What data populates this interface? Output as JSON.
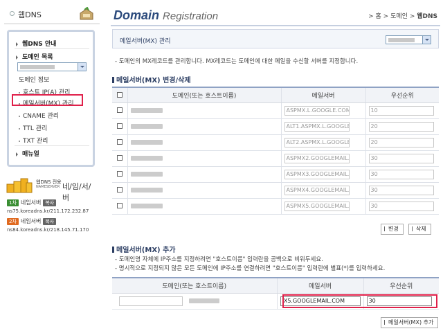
{
  "sidebar": {
    "title": "웹DNS",
    "menu": {
      "guide": "웹DNS 안내",
      "domain_list": "도메인 목록",
      "items": [
        "도메인 정보",
        "호스트 IP(A) 관리",
        "메일서버(MX) 관리",
        "CNAME 관리",
        "TTL 관리",
        "TXT 관리"
      ],
      "manual": "매뉴얼"
    },
    "nameserver": {
      "brand_small": "웹DNS 전용",
      "brand_sub": "NAMESERVER",
      "brand_big": "네/임/서/버",
      "primary": {
        "badge": "1차",
        "label": "네임서버",
        "copy": "복사",
        "address": "ns75.koreadns.kr/211.172.232.87"
      },
      "secondary": {
        "badge": "2차",
        "label": "네임서버",
        "copy": "복사",
        "address": "ns84.koreadns.kr/218.145.71.170"
      }
    }
  },
  "header": {
    "logo_main": "Domain",
    "logo_sub": "Registration",
    "breadcrumb": {
      "home": "홈",
      "sep": ">",
      "middle": "도메인",
      "current": "웹DNS"
    }
  },
  "panel": {
    "title": "메일서버(MX) 관리",
    "description": "- 도메인의 MX레코드를 관리합니다. MX레코드는 도메인에 대한 메일을 수신할 서버를 지정합니다."
  },
  "edit_section": {
    "title": "메일서버(MX) 변경/삭제",
    "columns": [
      "도메인(또는 호스트이름)",
      "메일서버",
      "우선순위"
    ],
    "rows": [
      {
        "mail": "ASPMX.L.GOOGLE.COM",
        "priority": "10"
      },
      {
        "mail": "ALT1.ASPMX.L.GOOGLE",
        "priority": "20"
      },
      {
        "mail": "ALT2.ASPMX.L.GOOGLE",
        "priority": "20"
      },
      {
        "mail": "ASPMX2.GOOGLEMAIL.",
        "priority": "30"
      },
      {
        "mail": "ASPMX3.GOOGLEMAIL.",
        "priority": "30"
      },
      {
        "mail": "ASPMX4.GOOGLEMAIL.",
        "priority": "30"
      },
      {
        "mail": "ASPMX5.GOOGLEMAIL.",
        "priority": "30"
      }
    ],
    "change_label": "변경",
    "delete_label": "삭제"
  },
  "add_section": {
    "title": "메일서버(MX) 추가",
    "notes": [
      "- 도메인명 자체에 IP주소를 지정하려면 \"호스트이름\" 입력란을 공백으로 비워두세요.",
      "- 명시적으로 지정되지 않은 모든 도메인에 IP주소를 연결하려면 \"호스트이름\" 입력란에 별표(*)를 입력하세요."
    ],
    "columns": [
      "도메인(또는 호스트이름)",
      "메일서버",
      "우선순위"
    ],
    "mail_value": "IX5.GOOGLEMAIL.COM",
    "priority_value": "30",
    "add_label": "메일서버(MX) 추가"
  },
  "colors": {
    "accent": "#2c3e63",
    "highlight": "#e0204a",
    "badge_green": "#3a8e33",
    "badge_orange": "#e06a20"
  }
}
